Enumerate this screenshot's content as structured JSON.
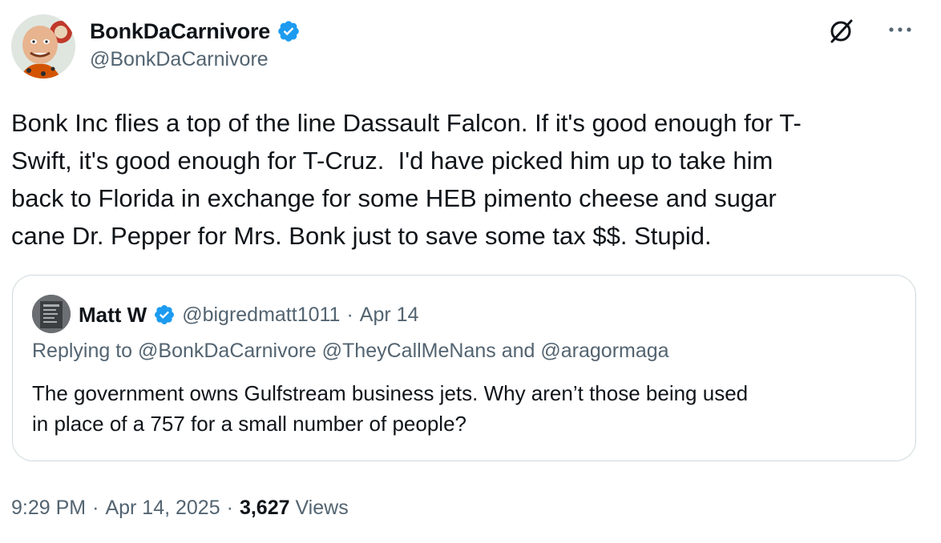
{
  "author": {
    "display_name": "BonkDaCarnivore",
    "handle": "@BonkDaCarnivore",
    "verified": true
  },
  "tweet": {
    "text": "Bonk Inc flies a top of the line Dassault Falcon. If it's good enough for T-\nSwift, it's good enough for T-Cruz.  I'd have picked him up to take him\nback to Florida in exchange for some HEB pimento cheese and sugar\ncane Dr. Pepper for Mrs. Bonk just to save some tax $$. Stupid."
  },
  "quote": {
    "display_name": "Matt W",
    "handle": "@bigredmatt1011",
    "separator": "·",
    "date": "Apr 14",
    "replying_to": "Replying to @BonkDaCarnivore @TheyCallMeNans and @aragormaga",
    "text": "The government owns Gulfstream business jets. Why aren’t those being used\nin place of a 757 for a small number of people?"
  },
  "meta": {
    "time": "9:29 PM",
    "separator": "·",
    "date": "Apr 14, 2025",
    "views_count": "3,627",
    "views_label": "Views"
  },
  "icons": {
    "more": "more-icon",
    "grok": "grok-icon",
    "verified": "verified-badge-icon"
  },
  "colors": {
    "verified_blue": "#1d9bf0",
    "secondary_text": "#536471",
    "primary_text": "#0f1419",
    "border": "#cfd9de"
  }
}
